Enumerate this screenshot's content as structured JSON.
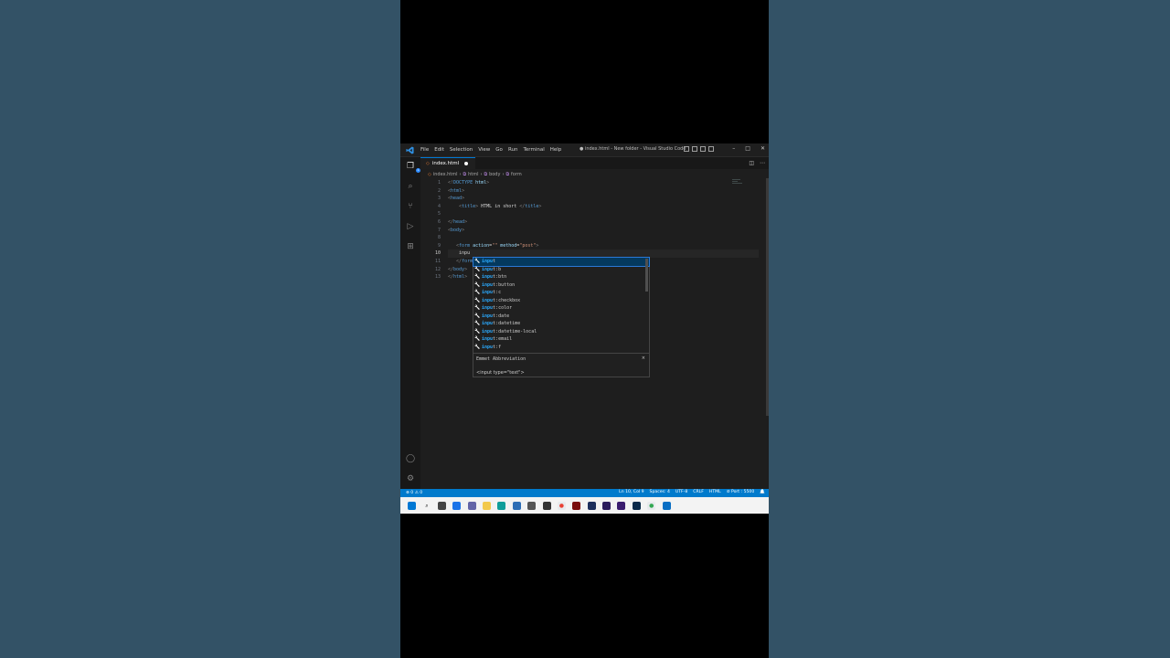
{
  "window": {
    "title": "● index.html - New folder - Visual Studio Code",
    "menu": [
      "File",
      "Edit",
      "Selection",
      "View",
      "Go",
      "Run",
      "Terminal",
      "Help"
    ]
  },
  "tab": {
    "label": "index.html"
  },
  "breadcrumb": [
    "index.html",
    "html",
    "body",
    "form"
  ],
  "editor": {
    "lines": [
      [
        {
          "t": "<!",
          "c": "br"
        },
        {
          "t": "DOCTYPE",
          "c": "tag"
        },
        {
          "t": " html",
          "c": "attr"
        },
        {
          "t": ">",
          "c": "br"
        }
      ],
      [
        {
          "t": "<",
          "c": "br"
        },
        {
          "t": "html",
          "c": "tag"
        },
        {
          "t": ">",
          "c": "br"
        }
      ],
      [
        {
          "t": "<",
          "c": "br"
        },
        {
          "t": "head",
          "c": "tag"
        },
        {
          "t": ">",
          "c": "br"
        }
      ],
      [
        {
          "t": "    ",
          "c": "txt"
        },
        {
          "t": "<",
          "c": "br"
        },
        {
          "t": "title",
          "c": "tag"
        },
        {
          "t": ">",
          "c": "br"
        },
        {
          "t": " HTML in short ",
          "c": "txt"
        },
        {
          "t": "</",
          "c": "br"
        },
        {
          "t": "title",
          "c": "tag"
        },
        {
          "t": ">",
          "c": "br"
        }
      ],
      [],
      [
        {
          "t": "</",
          "c": "br"
        },
        {
          "t": "head",
          "c": "tag"
        },
        {
          "t": ">",
          "c": "br"
        }
      ],
      [
        {
          "t": "<",
          "c": "br"
        },
        {
          "t": "body",
          "c": "tag"
        },
        {
          "t": ">",
          "c": "br"
        }
      ],
      [],
      [
        {
          "t": "   ",
          "c": "txt"
        },
        {
          "t": "<",
          "c": "br"
        },
        {
          "t": "form",
          "c": "tag"
        },
        {
          "t": " action",
          "c": "attr"
        },
        {
          "t": "=",
          "c": "txt"
        },
        {
          "t": "\"\"",
          "c": "str"
        },
        {
          "t": " method",
          "c": "attr"
        },
        {
          "t": "=",
          "c": "txt"
        },
        {
          "t": "\"post\"",
          "c": "str"
        },
        {
          "t": ">",
          "c": "br"
        }
      ],
      [
        {
          "t": "    inpu",
          "c": "txt"
        }
      ],
      [
        {
          "t": "   ",
          "c": "txt"
        },
        {
          "t": "</",
          "c": "br"
        },
        {
          "t": "form",
          "c": "tag"
        },
        {
          "t": ">",
          "c": "br"
        }
      ],
      [
        {
          "t": "</",
          "c": "br"
        },
        {
          "t": "body",
          "c": "tag"
        },
        {
          "t": ">",
          "c": "br"
        }
      ],
      [
        {
          "t": "</",
          "c": "br"
        },
        {
          "t": "html",
          "c": "tag"
        },
        {
          "t": ">",
          "c": "br"
        }
      ]
    ],
    "line_numbers": [
      "1",
      "2",
      "3",
      "4",
      "5",
      "6",
      "7",
      "8",
      "9",
      "10",
      "11",
      "12",
      "13"
    ],
    "active_line": 10
  },
  "suggest": {
    "items": [
      "input",
      "input:b",
      "input:btn",
      "input:button",
      "input:c",
      "input:checkbox",
      "input:color",
      "input:date",
      "input:datetime",
      "input:datetime-local",
      "input:email",
      "input:f"
    ],
    "match_prefix": "inpu",
    "details_title": "Emmet Abbreviation",
    "details_body": "<input type=\"text\">",
    "close_glyph": "×"
  },
  "statusbar": {
    "left": "⊗ 0 ⚠ 0",
    "right": [
      "Ln 10, Col 9",
      "Spaces: 4",
      "UTF-8",
      "CRLF",
      "HTML",
      "⊘ Port : 5500"
    ]
  },
  "colors": {
    "accent": "#007acc",
    "background": "#1e1e1e"
  }
}
